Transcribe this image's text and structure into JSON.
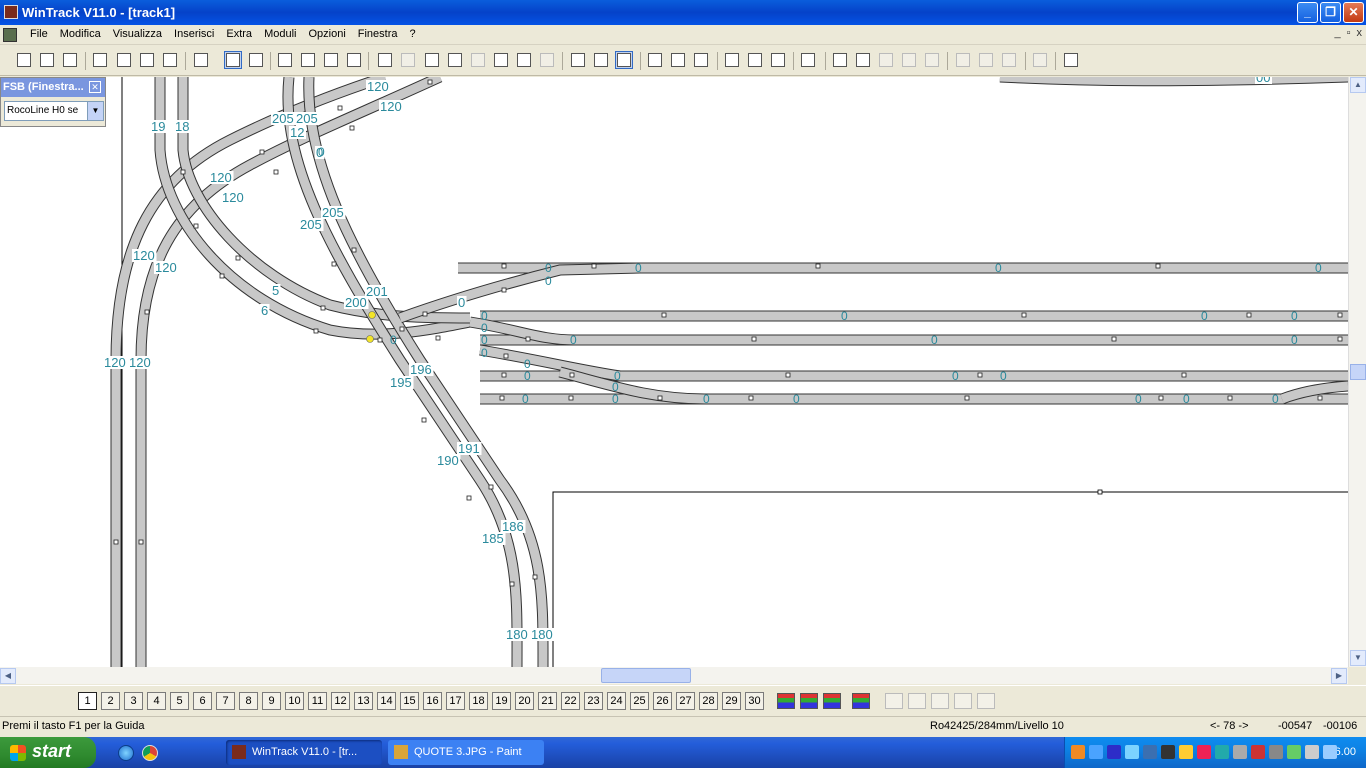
{
  "window": {
    "title": "WinTrack  V11.0 - [track1]",
    "minimize_icon": "minimize-icon",
    "maximize_icon": "restore-icon",
    "close_icon": "close-icon"
  },
  "menu": {
    "items": [
      "File",
      "Modifica",
      "Visualizza",
      "Inserisci",
      "Extra",
      "Moduli",
      "Opzioni",
      "Finestra",
      "?"
    ],
    "mdi_buttons": [
      "_",
      "▫",
      "x"
    ]
  },
  "panel": {
    "title": "FSB (Finestra...",
    "selected": "RocoLine H0 se"
  },
  "canvas": {
    "labels": [
      {
        "t": "19"
      },
      {
        "t": "18"
      },
      {
        "t": "120"
      },
      {
        "t": "120"
      },
      {
        "t": "205"
      },
      {
        "t": "205"
      },
      {
        "t": "12"
      },
      {
        "t": "0"
      },
      {
        "t": "120"
      },
      {
        "t": "120"
      },
      {
        "t": "120"
      },
      {
        "t": "120"
      },
      {
        "t": "205"
      },
      {
        "t": "205"
      },
      {
        "t": "5"
      },
      {
        "t": "6"
      },
      {
        "t": "200"
      },
      {
        "t": "201"
      },
      {
        "t": "0"
      },
      {
        "t": "120"
      },
      {
        "t": "120"
      },
      {
        "t": "196"
      },
      {
        "t": "195"
      },
      {
        "t": "191"
      },
      {
        "t": "190"
      },
      {
        "t": "186"
      },
      {
        "t": "185"
      },
      {
        "t": "180"
      },
      {
        "t": "180"
      },
      {
        "t": "00"
      }
    ],
    "zero_markers": "0"
  },
  "layers": {
    "numbers": [
      "1",
      "2",
      "3",
      "4",
      "5",
      "6",
      "7",
      "8",
      "9",
      "10",
      "11",
      "12",
      "13",
      "14",
      "15",
      "16",
      "17",
      "18",
      "19",
      "20",
      "21",
      "22",
      "23",
      "24",
      "25",
      "26",
      "27",
      "28",
      "29",
      "30"
    ],
    "active": "1"
  },
  "status": {
    "help": "Premi il tasto F1 per la Guida",
    "article": "Ro42425/284mm/Livello 10",
    "angle": "<- 78 ->",
    "x": "-00547",
    "y": "-00106"
  },
  "taskbar": {
    "start": "start",
    "tasks": [
      "WinTrack  V11.0 - [tr...",
      "QUOTE 3.JPG - Paint"
    ],
    "clock": "16.00"
  },
  "colors": {
    "track_fill": "#c8c8c8",
    "track_stroke": "#333333",
    "label": "#2a8a9c",
    "titlebar": "#0a5ddc",
    "taskbar": "#245edb"
  }
}
